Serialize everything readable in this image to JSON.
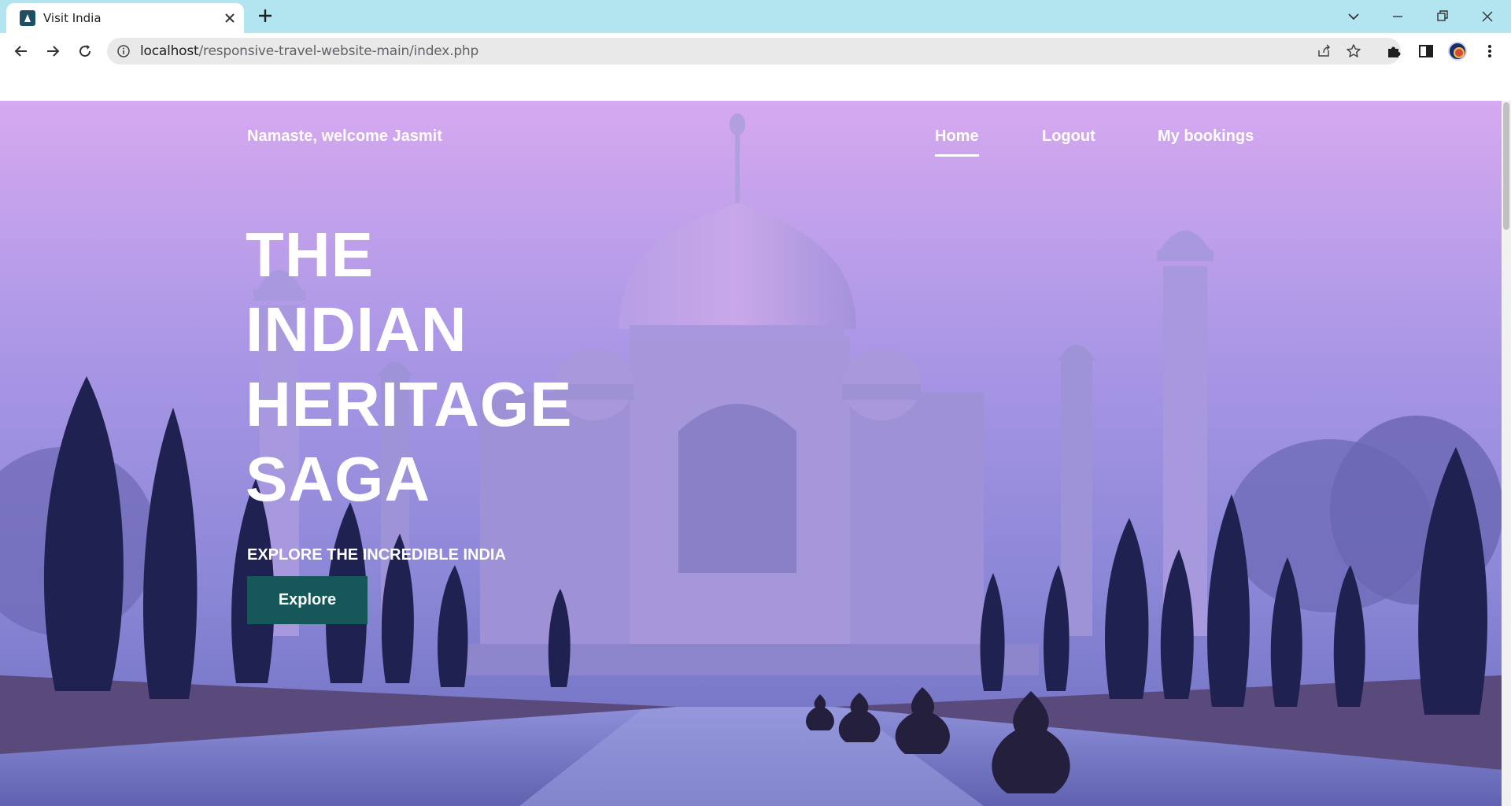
{
  "browser": {
    "tab_title": "Visit India",
    "url_host": "localhost",
    "url_path": "/responsive-travel-website-main/index.php"
  },
  "nav": {
    "welcome": "Namaste, welcome Jasmit",
    "links": [
      "Home",
      "Logout",
      "My bookings"
    ],
    "active": "Home"
  },
  "hero": {
    "title_lines": [
      "THE",
      "INDIAN",
      "HERITAGE",
      "SAGA"
    ],
    "subtitle": "EXPLORE THE INCREDIBLE INDIA",
    "button_label": "Explore"
  },
  "colors": {
    "tabbar": "#b3e5f0",
    "button": "#16585a",
    "sky_top": "#c9a2ec",
    "sky_bottom": "#585aa8"
  }
}
